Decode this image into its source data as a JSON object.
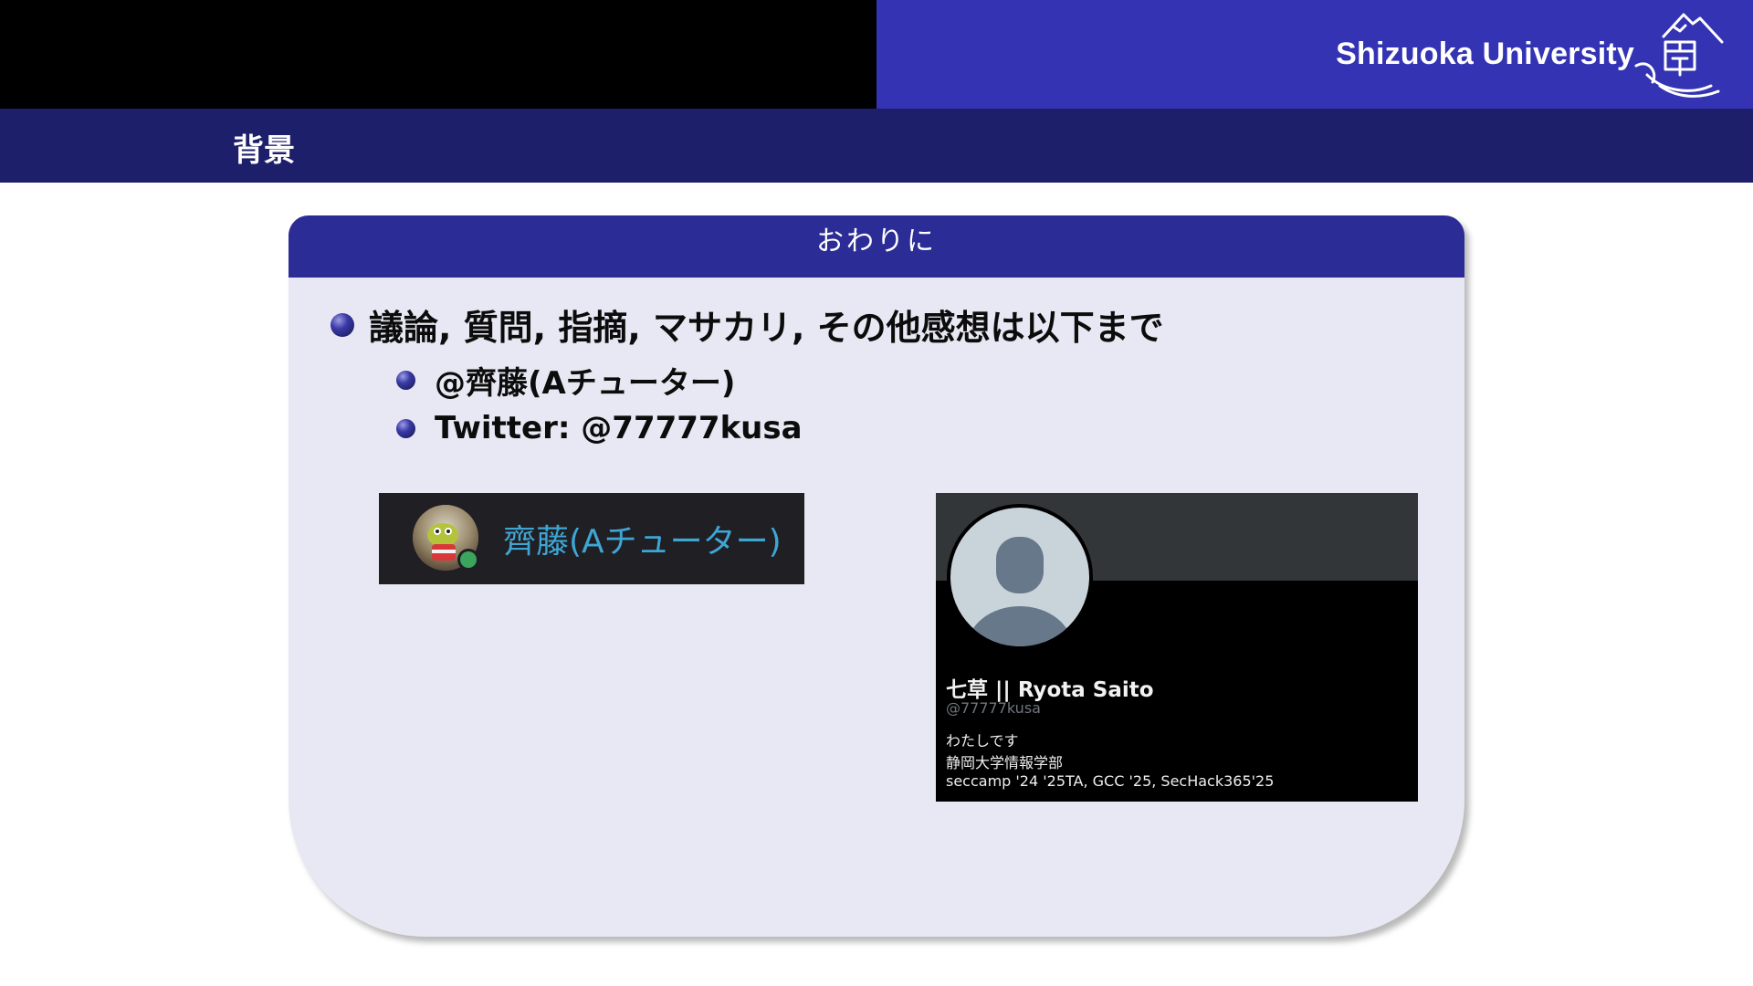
{
  "header": {
    "brand": "Shizuoka University",
    "section": "背景"
  },
  "block": {
    "title": "おわりに",
    "bullet_main": "議論, 質問, 指摘, マサカリ, その他感想は以下まで",
    "sub_items": [
      "@齊藤(Aチューター)",
      "Twitter: @77777kusa"
    ]
  },
  "discord_card": {
    "display_name": "齊藤(Aチューター)"
  },
  "twitter_card": {
    "name": "七草 || Ryota Saito",
    "handle": "@77777kusa",
    "bio_lines": [
      "わたしです",
      "静岡大学情報学部",
      "seccamp '24 '25TA, GCC '25, SecHack365'25"
    ]
  },
  "colors": {
    "header_accent": "#3333b3",
    "section_bar": "#1e1f6b",
    "block_header": "#2c2c96",
    "block_body": "#e8e8f4",
    "discord_name": "#3fa6d4",
    "status_online": "#3ba55d"
  },
  "icons": {
    "crest": "university-crest-icon",
    "bullet": "ball-bullet-icon",
    "default_avatar": "default-profile-icon"
  }
}
